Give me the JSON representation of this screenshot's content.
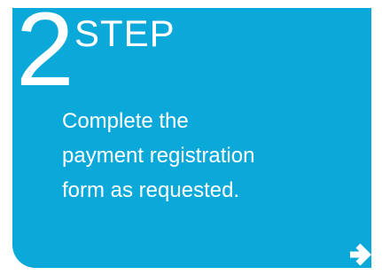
{
  "step": {
    "number": "2",
    "label": "STEP",
    "description": "Complete the payment registration form as requested.",
    "next_icon": "arrow-right-icon"
  },
  "colors": {
    "card_background": "#0ba9d9",
    "text": "#ffffff"
  }
}
